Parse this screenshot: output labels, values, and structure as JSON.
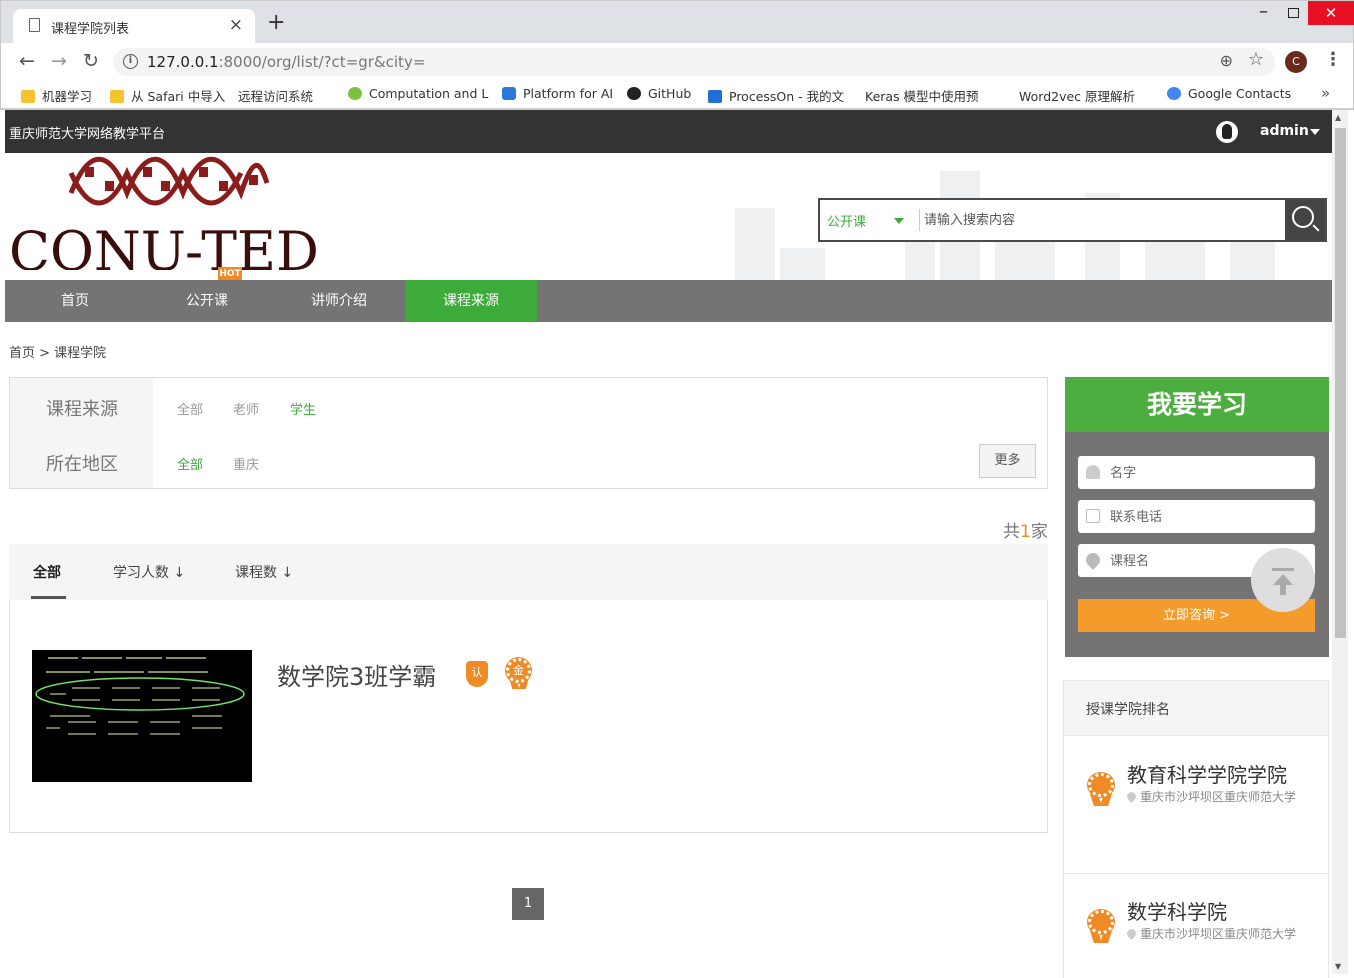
{
  "browser": {
    "tab_title": "课程学院列表",
    "url_host": "127.0.0.1",
    "url_rest": ":8000/org/list/?ct=gr&city=",
    "avatar_letter": "C",
    "bookmarks": [
      {
        "label": "机器学习",
        "icon": "folder-icon"
      },
      {
        "label": "从 Safari 中导入",
        "icon": "folder-icon"
      },
      {
        "label": "远程访问系统",
        "icon": "page-icon"
      },
      {
        "label": "Computation and L",
        "icon": "smile-icon"
      },
      {
        "label": "Platform for AI",
        "icon": "cube-icon"
      },
      {
        "label": "GitHub",
        "icon": "github-icon"
      },
      {
        "label": "ProcessOn - 我的文",
        "icon": "processon-icon"
      },
      {
        "label": "Keras 模型中使用预",
        "icon": "page-icon"
      },
      {
        "label": "Word2vec 原理解析",
        "icon": "page-icon"
      },
      {
        "label": "Google Contacts",
        "icon": "contacts-icon"
      }
    ]
  },
  "site": {
    "platform_name": "重庆师范大学网络教学平台",
    "username": "admin",
    "logo_text": "CQNU-TED",
    "hot_badge": "HOT"
  },
  "search": {
    "type": "公开课",
    "placeholder": "请输入搜索内容"
  },
  "nav": [
    "首页",
    "公开课",
    "讲师介绍",
    "课程来源"
  ],
  "breadcrumb": "首页 > 课程学院",
  "filters": {
    "source_label": "课程来源",
    "source_options": [
      "全部",
      "老师",
      "学生"
    ],
    "region_label": "所在地区",
    "region_options": [
      "全部",
      "重庆"
    ],
    "more": "更多"
  },
  "count": {
    "prefix": "共",
    "num": "1",
    "suffix": "家"
  },
  "sort_tabs": [
    "全部",
    "学习人数 ↓",
    "课程数 ↓"
  ],
  "orgs": [
    {
      "name": "数学院3班学霸",
      "badge_cert": "认",
      "badge_gold": "金"
    }
  ],
  "pager": [
    "1"
  ],
  "learn_form": {
    "title": "我要学习",
    "name_placeholder": "名字",
    "phone_placeholder": "联系电话",
    "course_placeholder": "课程名",
    "submit": "立即咨询 >"
  },
  "ranking": {
    "title": "授课学院排名",
    "items": [
      {
        "name": "教育科学学院学院",
        "address": "重庆市沙坪坝区重庆师范大学"
      },
      {
        "name": "数学科学院",
        "address": "重庆市沙坪坝区重庆师范大学"
      }
    ]
  },
  "colors": {
    "accent_green": "#3cab3a",
    "accent_orange": "#f08a24",
    "topbar": "#333333"
  }
}
